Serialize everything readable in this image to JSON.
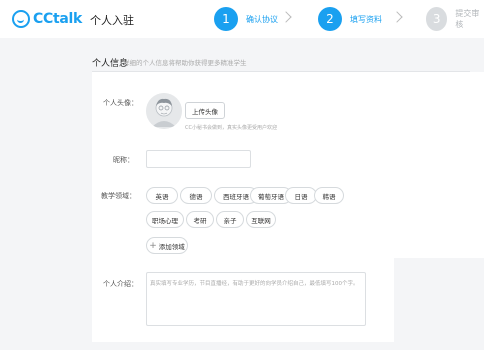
{
  "header": {
    "logo_text": "CCtalk",
    "page_title": "个人入驻",
    "steps": [
      {
        "number": "1",
        "label": "确认协议"
      },
      {
        "number": "2",
        "label": "填写资料"
      },
      {
        "number": "3",
        "label": "提交审核"
      }
    ]
  },
  "section": {
    "title": "个人信息",
    "subtitle": "详细的个人信息将帮助你获得更多精准学生"
  },
  "avatar": {
    "label": "个人头像：",
    "upload_button": "上传头像",
    "hint": "CC小秘书会做到，真实头像更受用户欢迎"
  },
  "nickname": {
    "label": "昵称：",
    "value": "",
    "placeholder": ""
  },
  "teaching": {
    "label": "教学领域：",
    "tags": [
      "英语",
      "德语",
      "西班牙语",
      "葡萄牙语",
      "日语",
      "韩语",
      "职场心理",
      "考研",
      "亲子",
      "互联网"
    ],
    "add_label": "添加领域"
  },
  "intro": {
    "label": "个人介绍：",
    "placeholder": "真实填写专业学历，节目直播经，有助于更好的向学员介绍自己，最低填写100个字。"
  },
  "colors": {
    "accent": "#1aa0f0",
    "step_inactive": "#d9dcdf",
    "background": "#f4f5f7"
  }
}
